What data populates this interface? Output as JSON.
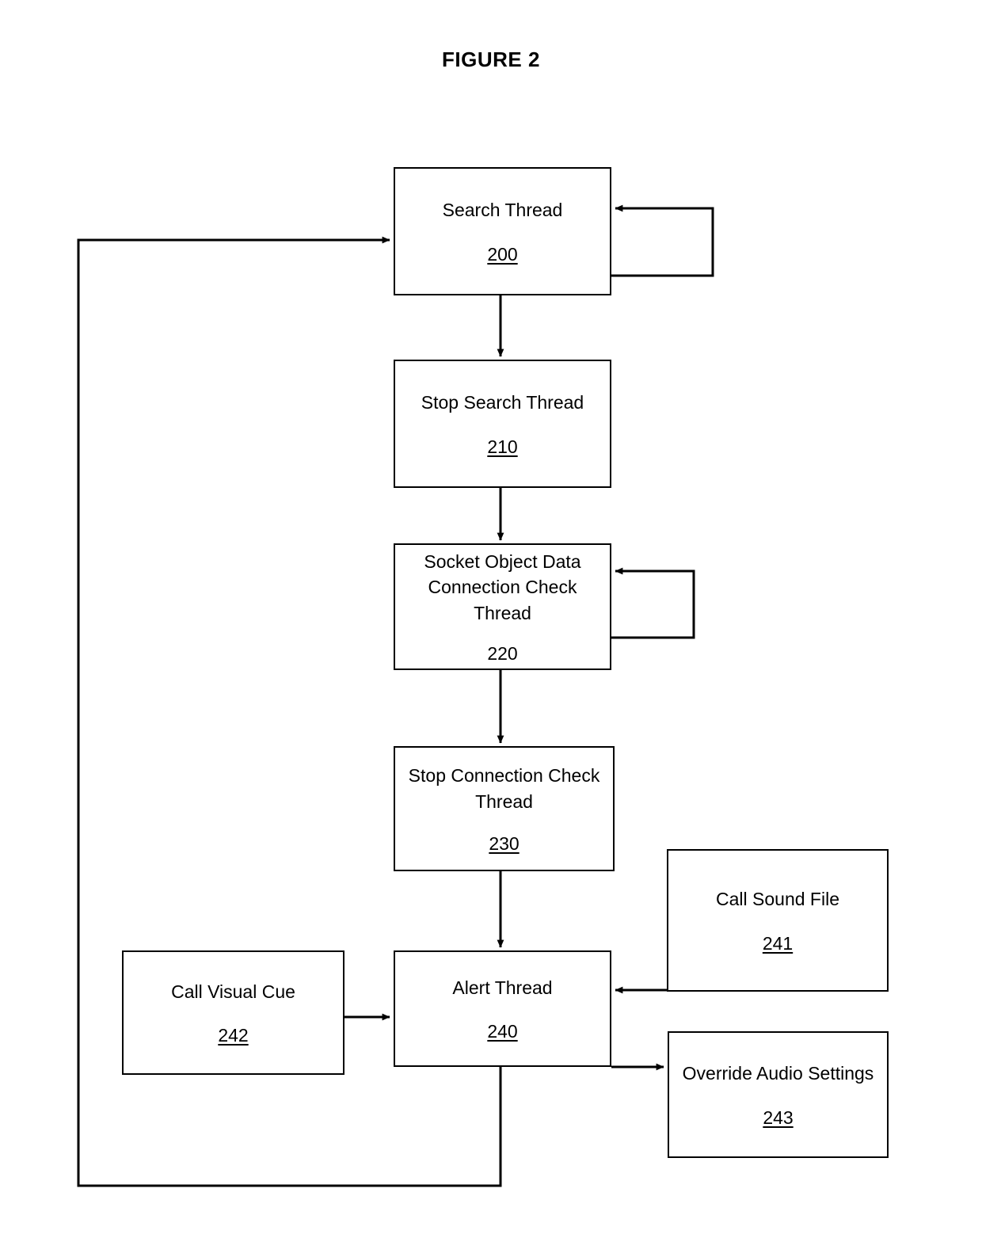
{
  "figure": {
    "title": "FIGURE 2"
  },
  "diagram": {
    "type": "flowchart",
    "nodes": [
      {
        "id": "200",
        "label": "Search Thread",
        "ref": "200",
        "ref_underlined": true
      },
      {
        "id": "210",
        "label": "Stop Search Thread",
        "ref": "210",
        "ref_underlined": true
      },
      {
        "id": "220",
        "label": "Socket Object Data\nConnection Check\nThread",
        "ref": "220",
        "ref_underlined": false
      },
      {
        "id": "230",
        "label": "Stop Connection Check\nThread",
        "ref": "230",
        "ref_underlined": true
      },
      {
        "id": "240",
        "label": "Alert Thread",
        "ref": "240",
        "ref_underlined": true
      },
      {
        "id": "241",
        "label": "Call Sound File",
        "ref": "241",
        "ref_underlined": true
      },
      {
        "id": "242",
        "label": "Call Visual Cue",
        "ref": "242",
        "ref_underlined": true
      },
      {
        "id": "243",
        "label": "Override Audio Settings",
        "ref": "243",
        "ref_underlined": true
      }
    ],
    "edges": [
      {
        "from": "200",
        "to": "210",
        "kind": "arrow"
      },
      {
        "from": "210",
        "to": "220",
        "kind": "arrow"
      },
      {
        "from": "220",
        "to": "230",
        "kind": "arrow"
      },
      {
        "from": "230",
        "to": "240",
        "kind": "arrow"
      },
      {
        "from": "200",
        "to": "200",
        "kind": "self-loop-right"
      },
      {
        "from": "220",
        "to": "220",
        "kind": "self-loop-right"
      },
      {
        "from": "241",
        "to": "240",
        "kind": "arrow"
      },
      {
        "from": "242",
        "to": "240",
        "kind": "arrow"
      },
      {
        "from": "240",
        "to": "243",
        "kind": "arrow"
      },
      {
        "from": "240",
        "to": "200",
        "kind": "feedback-loop-left"
      }
    ]
  },
  "colors": {
    "line": "#000000",
    "background": "#ffffff",
    "text": "#000000"
  }
}
